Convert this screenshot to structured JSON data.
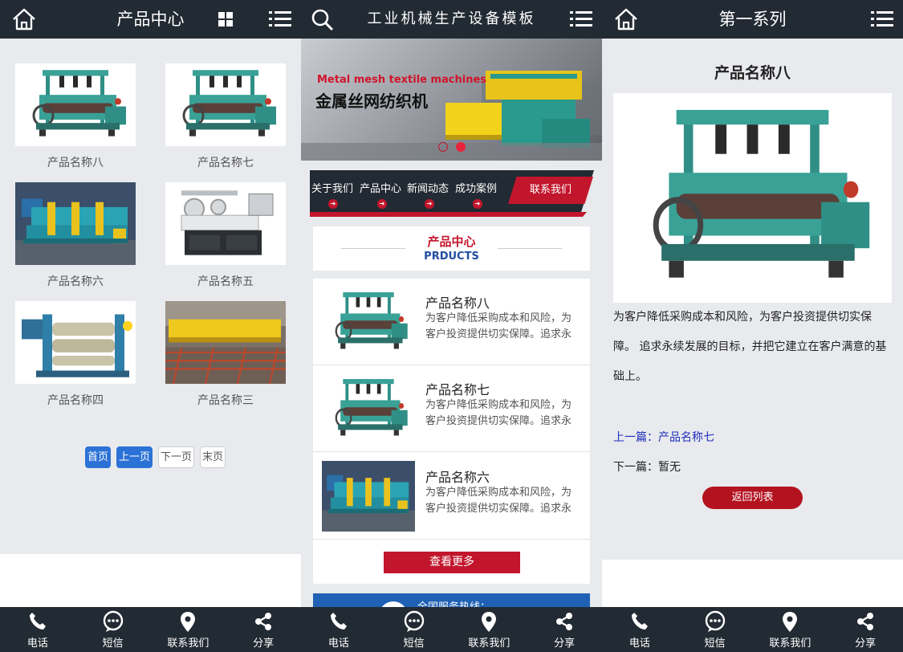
{
  "colors": {
    "header_bg": "#222a33",
    "accent_red": "#c2162d",
    "pager_active": "#2c72d6",
    "link_blue": "#1f2fbd",
    "hotline_blue": "#1f62b5"
  },
  "icons": {
    "home": "home-icon",
    "grid": "grid-icon",
    "menu": "menu-icon",
    "search": "search-icon",
    "phone": "phone-icon",
    "sms": "sms-icon",
    "location": "location-pin-icon",
    "share": "share-icon"
  },
  "footer": [
    "电话",
    "短信",
    "联系我们",
    "分享"
  ],
  "panel1": {
    "title": "产品中心",
    "products": [
      "产品名称八",
      "产品名称七",
      "产品名称六",
      "产品名称五",
      "产品名称四",
      "产品名称三"
    ],
    "pager": [
      "首页",
      "上一页",
      "下一页",
      "末页"
    ]
  },
  "panel2": {
    "title": "工业机械生产设备模板",
    "banner": {
      "en": "Metal mesh textile machines",
      "cn": "金属丝网纺织机",
      "slide_count": 2,
      "active_slide": 2
    },
    "nav": [
      "关于我们",
      "产品中心",
      "新闻动态",
      "成功案例"
    ],
    "nav_contact": "联系我们",
    "section": {
      "cn": "产品中心",
      "en": "PRDUCTS"
    },
    "products": [
      {
        "name": "产品名称八",
        "desc": "为客户降低采购成本和风险，为客户投资提供切实保障。追求永续发展的目标"
      },
      {
        "name": "产品名称七",
        "desc": "为客户降低采购成本和风险，为客户投资提供切实保障。追求永续发展的目标"
      },
      {
        "name": "产品名称六",
        "desc": "为客户降低采购成本和风险，为客户投资提供切实保障。追求永续发展的目标"
      }
    ],
    "more": "查看更多",
    "hotline": "全国服务热线："
  },
  "panel3": {
    "title": "第一系列",
    "product_name": "产品名称八",
    "description": "为客户降低采购成本和风险，为客户投资提供切实保障。 追求永续发展的目标，并把它建立在客户满意的基础上。",
    "prev_label": "上一篇：产品名称七",
    "next_label": "下一篇：暂无",
    "back": "返回列表"
  }
}
